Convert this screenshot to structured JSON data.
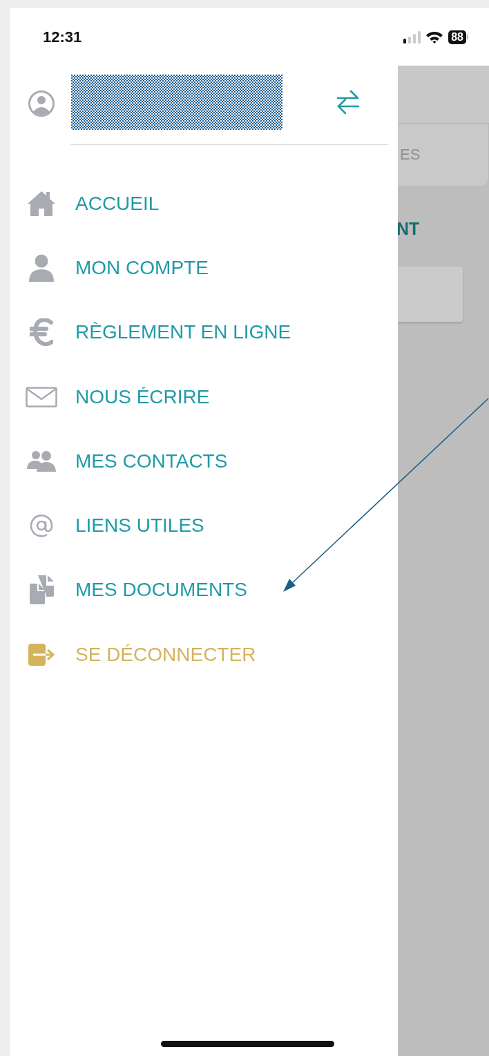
{
  "status_bar": {
    "time": "12:31",
    "battery": "88"
  },
  "drawer": {
    "items": [
      {
        "label": "ACCUEIL",
        "kind": "link"
      },
      {
        "label": "MON COMPTE",
        "kind": "link"
      },
      {
        "label": "RÈGLEMENT EN LIGNE",
        "kind": "link"
      },
      {
        "label": "NOUS ÉCRIRE",
        "kind": "link"
      },
      {
        "label": "MES CONTACTS",
        "kind": "link"
      },
      {
        "label": "LIENS UTILES",
        "kind": "link"
      },
      {
        "label": "MES DOCUMENTS",
        "kind": "link"
      },
      {
        "label": "SE DÉCONNECTER",
        "kind": "logout"
      }
    ]
  },
  "background_screen": {
    "tab": "ES",
    "heading": "NT"
  }
}
